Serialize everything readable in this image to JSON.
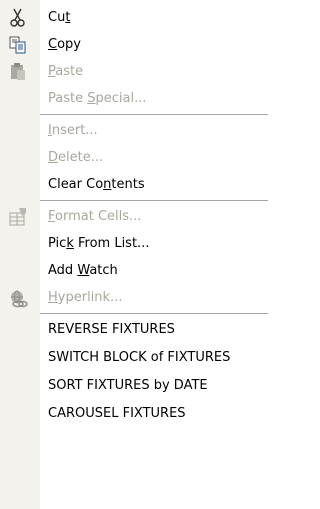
{
  "menu": {
    "items": [
      {
        "label": "Cut",
        "pre": "Cu",
        "key": "t",
        "post": "",
        "enabled": true,
        "icon": "scissors-icon"
      },
      {
        "label": "Copy",
        "pre": "",
        "key": "C",
        "post": "opy",
        "enabled": true,
        "icon": "copy-icon"
      },
      {
        "label": "Paste",
        "pre": "",
        "key": "P",
        "post": "aste",
        "enabled": false,
        "icon": "paste-icon"
      },
      {
        "label": "Paste Special...",
        "pre": "Paste ",
        "key": "S",
        "post": "pecial...",
        "enabled": false,
        "icon": null
      },
      {
        "label": "Insert...",
        "pre": "",
        "key": "I",
        "post": "nsert...",
        "enabled": false,
        "icon": null
      },
      {
        "label": "Delete...",
        "pre": "",
        "key": "D",
        "post": "elete...",
        "enabled": false,
        "icon": null
      },
      {
        "label": "Clear Contents",
        "pre": "Clear Co",
        "key": "n",
        "post": "tents",
        "enabled": true,
        "icon": null
      },
      {
        "label": "Format Cells...",
        "pre": "",
        "key": "F",
        "post": "ormat Cells...",
        "enabled": false,
        "icon": "format-cells-icon"
      },
      {
        "label": "Pick From List...",
        "pre": "Pic",
        "key": "k",
        "post": " From List...",
        "enabled": true,
        "icon": null
      },
      {
        "label": "Add Watch",
        "pre": "Add ",
        "key": "W",
        "post": "atch",
        "enabled": true,
        "icon": null
      },
      {
        "label": "Hyperlink...",
        "pre": "",
        "key": "H",
        "post": "yperlink...",
        "enabled": false,
        "icon": "hyperlink-icon"
      },
      {
        "label": "REVERSE FIXTURES",
        "pre": "REVERSE FIXTURES",
        "key": "",
        "post": "",
        "enabled": true,
        "icon": null
      },
      {
        "label": "SWITCH BLOCK of FIXTURES",
        "pre": "SWITCH BLOCK of FIXTURES",
        "key": "",
        "post": "",
        "enabled": true,
        "icon": null
      },
      {
        "label": "SORT FIXTURES by DATE",
        "pre": "SORT FIXTURES by DATE",
        "key": "",
        "post": "",
        "enabled": true,
        "icon": null
      },
      {
        "label": "CAROUSEL FIXTURES",
        "pre": "CAROUSEL FIXTURES",
        "key": "",
        "post": "",
        "enabled": true,
        "icon": null
      }
    ]
  },
  "colors": {
    "gutter": "#f3f2ec",
    "disabled_text": "#a8a89f",
    "separator": "#a7a6aa"
  }
}
